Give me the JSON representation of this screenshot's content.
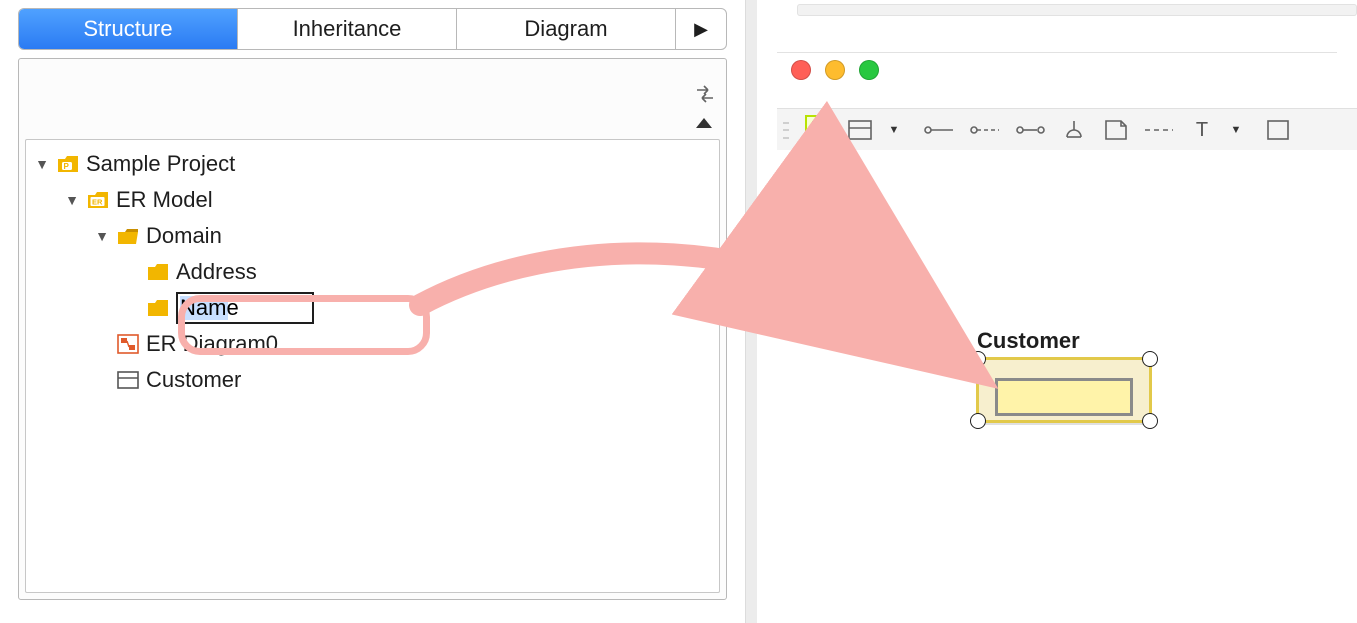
{
  "tabs": {
    "structure": "Structure",
    "inheritance": "Inheritance",
    "diagram": "Diagram"
  },
  "tree": {
    "root": "Sample Project",
    "erModel": "ER Model",
    "domain": "Domain",
    "address": "Address",
    "nameEditing": "Name",
    "erDiagram0": "ER Diagram0",
    "customer": "Customer"
  },
  "canvas": {
    "entityTitle": "Customer"
  },
  "icons": {
    "project": "P",
    "erModel": "ER",
    "text": "T"
  }
}
